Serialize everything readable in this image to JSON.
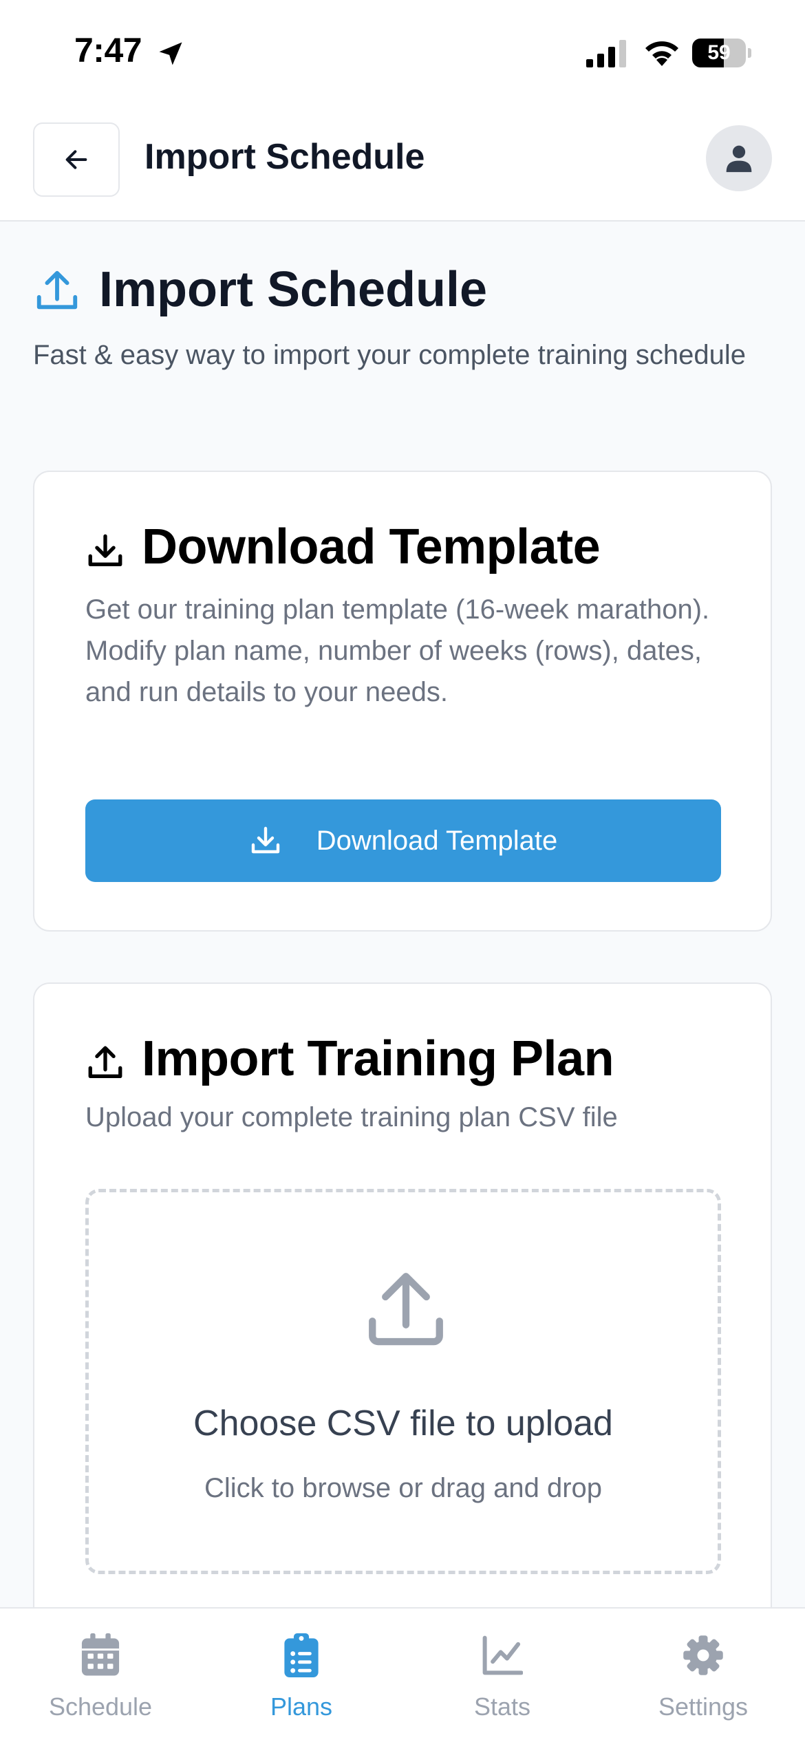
{
  "status_bar": {
    "time": "7:47",
    "battery": "59",
    "battery_level": 0.59
  },
  "header": {
    "title": "Import Schedule"
  },
  "page": {
    "title": "Import Schedule",
    "subtitle": "Fast & easy way to import your complete training schedule"
  },
  "download_card": {
    "title": "Download Template",
    "description": "Get our training plan template (16-week marathon). Modify plan name, number of weeks (rows), dates, and run details to your needs.",
    "button_label": "Download Template"
  },
  "import_card": {
    "title": "Import Training Plan",
    "description": "Upload your complete training plan CSV file",
    "dropzone_title": "Choose CSV file to upload",
    "dropzone_subtitle": "Click to browse or drag and drop"
  },
  "nav": {
    "items": [
      {
        "label": "Schedule",
        "icon": "calendar-icon"
      },
      {
        "label": "Plans",
        "icon": "clipboard-list-icon"
      },
      {
        "label": "Stats",
        "icon": "chart-line-icon"
      },
      {
        "label": "Settings",
        "icon": "gear-icon"
      }
    ],
    "active": "Plans"
  },
  "colors": {
    "accent": "#3498db",
    "text_primary": "#111827",
    "text_secondary": "#6b7280",
    "nav_inactive": "#9ca3af"
  }
}
